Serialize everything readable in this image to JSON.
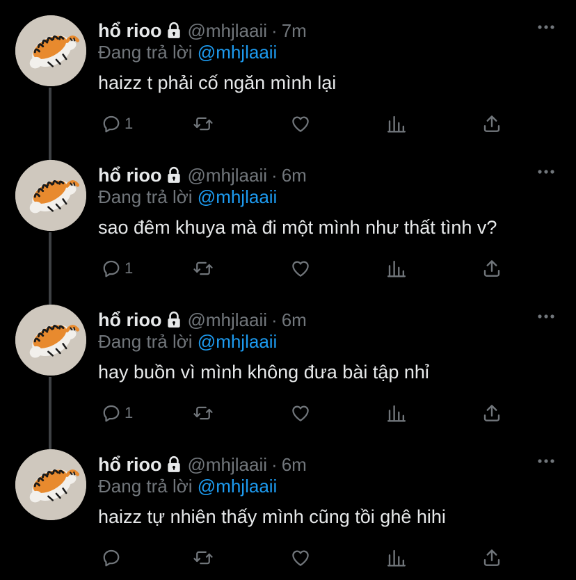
{
  "tweets": [
    {
      "name": "hổ rioo",
      "handle": "@mhjlaaii",
      "time": "7m",
      "reply_prefix": "Đang trả lời",
      "reply_to": "@mhjlaaii",
      "text": "haizz t phải cố ngăn mình lại",
      "reply_count": "1"
    },
    {
      "name": "hổ rioo",
      "handle": "@mhjlaaii",
      "time": "6m",
      "reply_prefix": "Đang trả lời",
      "reply_to": "@mhjlaaii",
      "text": "sao đêm khuya mà đi một mình như thất tình v?",
      "reply_count": "1"
    },
    {
      "name": "hổ rioo",
      "handle": "@mhjlaaii",
      "time": "6m",
      "reply_prefix": "Đang trả lời",
      "reply_to": "@mhjlaaii",
      "text": "hay buồn vì mình không đưa bài tập nhỉ",
      "reply_count": "1"
    },
    {
      "name": "hổ rioo",
      "handle": "@mhjlaaii",
      "time": "6m",
      "reply_prefix": "Đang trả lời",
      "reply_to": "@mhjlaaii",
      "text": "haizz tự nhiên thấy mình cũng tồi ghê hihi",
      "reply_count": ""
    }
  ],
  "separator": "·",
  "icons": {
    "avatar": "tiger-cartoon-avatar",
    "lock": "lock-icon",
    "more": "more-icon",
    "reply": "reply-icon",
    "retweet": "retweet-icon",
    "like": "like-icon",
    "analytics": "analytics-icon",
    "share": "share-icon"
  },
  "colors": {
    "background": "#000000",
    "text": "#e7e9ea",
    "muted": "#71767b",
    "link": "#1d9bf0",
    "thread_line": "#3e4144"
  }
}
